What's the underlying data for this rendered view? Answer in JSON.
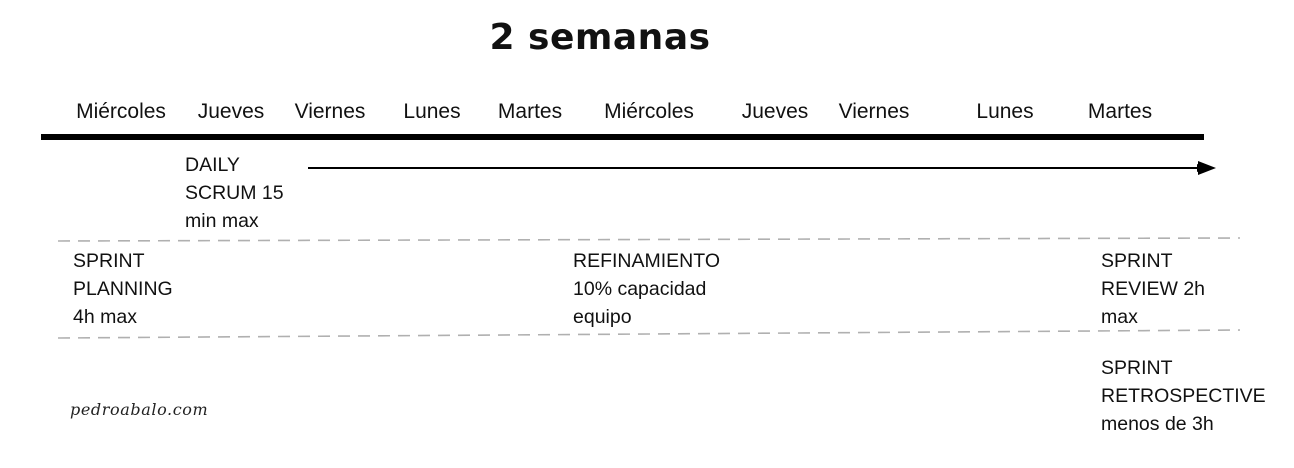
{
  "title": "2 semanas",
  "days": [
    "Miércoles",
    "Jueves",
    "Viernes",
    "Lunes",
    "Martes",
    "Miércoles",
    "Jueves",
    "Viernes",
    "Lunes",
    "Martes"
  ],
  "daily_scrum": {
    "lines": [
      "DAILY",
      "SCRUM 15",
      "min max"
    ]
  },
  "sprint_planning": {
    "lines": [
      "SPRINT",
      "PLANNING",
      "4h max"
    ]
  },
  "refinamiento": {
    "lines": [
      "REFINAMIENTO",
      "10% capacidad",
      "equipo"
    ]
  },
  "sprint_review": {
    "lines": [
      "SPRINT",
      "REVIEW 2h",
      "max"
    ]
  },
  "sprint_retrospective": {
    "lines": [
      "SPRINT",
      "RETROSPECTIVE",
      "menos de 3h"
    ]
  },
  "signature": "pedroabalo.com",
  "colors": {
    "text": "#111111",
    "timeline": "#000000",
    "dashed_separator": "#b0b0b0"
  }
}
